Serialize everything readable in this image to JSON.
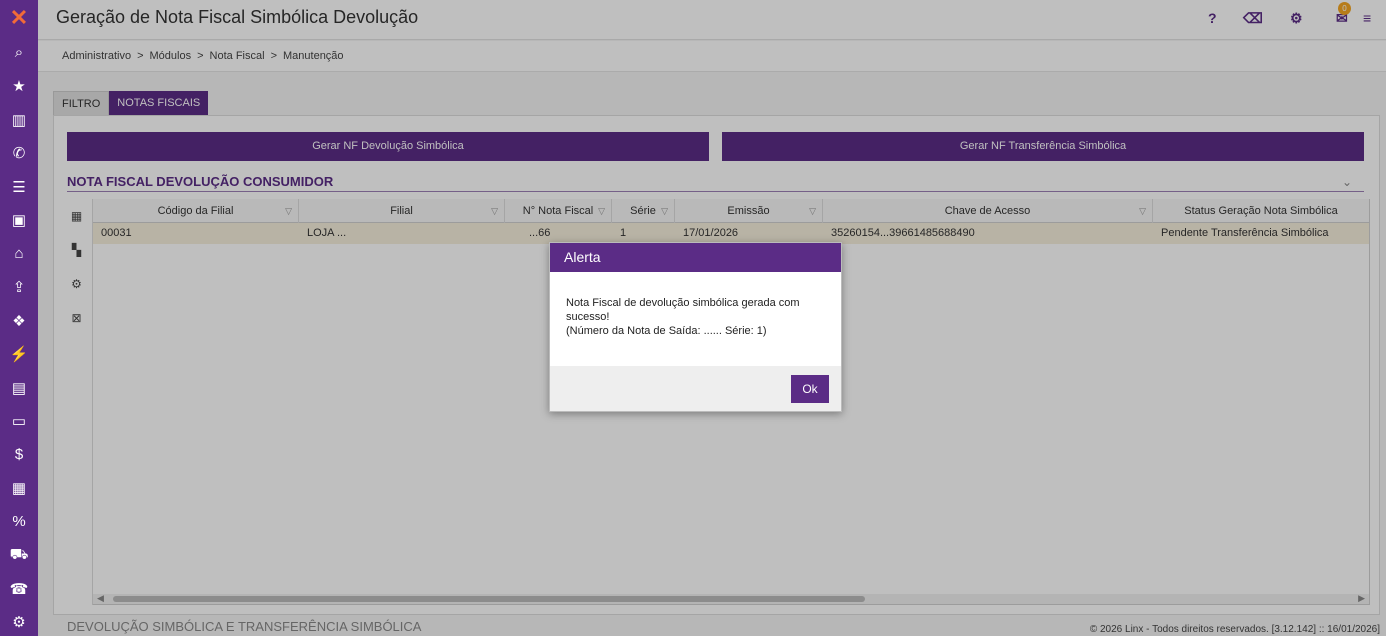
{
  "header": {
    "title": "Geração de Nota Fiscal Simbólica Devolução",
    "help": "?",
    "notification_count": "0"
  },
  "breadcrumb": [
    "Administrativo",
    "Módulos",
    "Nota Fiscal",
    "Manutenção"
  ],
  "breadcrumb_sep": ">",
  "tabs": [
    {
      "label": "FILTRO",
      "active": false
    },
    {
      "label": "NOTAS FISCAIS",
      "active": true
    }
  ],
  "actions": {
    "gerar_devolucao": "Gerar NF Devolução Simbólica",
    "gerar_transferencia": "Gerar NF Transferência Simbólica"
  },
  "section_title": "NOTA FISCAL DEVOLUÇÃO CONSUMIDOR",
  "grid": {
    "columns": [
      "Código da Filial",
      "Filial",
      "N° Nota Fiscal",
      "Série",
      "Emissão",
      "Chave de Acesso",
      "Status Geração Nota Simbólica"
    ],
    "rows": [
      [
        "00031",
        "LOJA ...",
        "...66",
        "1",
        "17/01/2026",
        "35260154...39661485688490",
        "Pendente Transferência Simbólica"
      ]
    ]
  },
  "modal": {
    "title": "Alerta",
    "line1": "Nota Fiscal de devolução simbólica gerada com sucesso!",
    "line2": "(Número da Nota de Saída: ...... Série: 1)",
    "ok": "Ok"
  },
  "bottom_section": "DEVOLUÇÃO SIMBÓLICA E TRANSFERÊNCIA SIMBÓLICA",
  "footer": "© 2026 Linx - Todos direitos reservados. [3.12.142] :: 16/01/2026]",
  "colors": {
    "brand": "#5b2c86",
    "accent": "#f26b38",
    "row_highlight": "#f6efdd"
  },
  "icons": [
    "logo-x-icon",
    "search-icon",
    "star-icon",
    "chart-icon",
    "phone-icon",
    "list-icon",
    "contact-icon",
    "basket-icon",
    "upload-icon",
    "dropbox-icon",
    "plug-icon",
    "bar-chart-icon",
    "monitor-icon",
    "dollar-icon",
    "boxes-icon",
    "percent-icon",
    "cart-icon",
    "phone-book-icon",
    "settings-icon"
  ]
}
